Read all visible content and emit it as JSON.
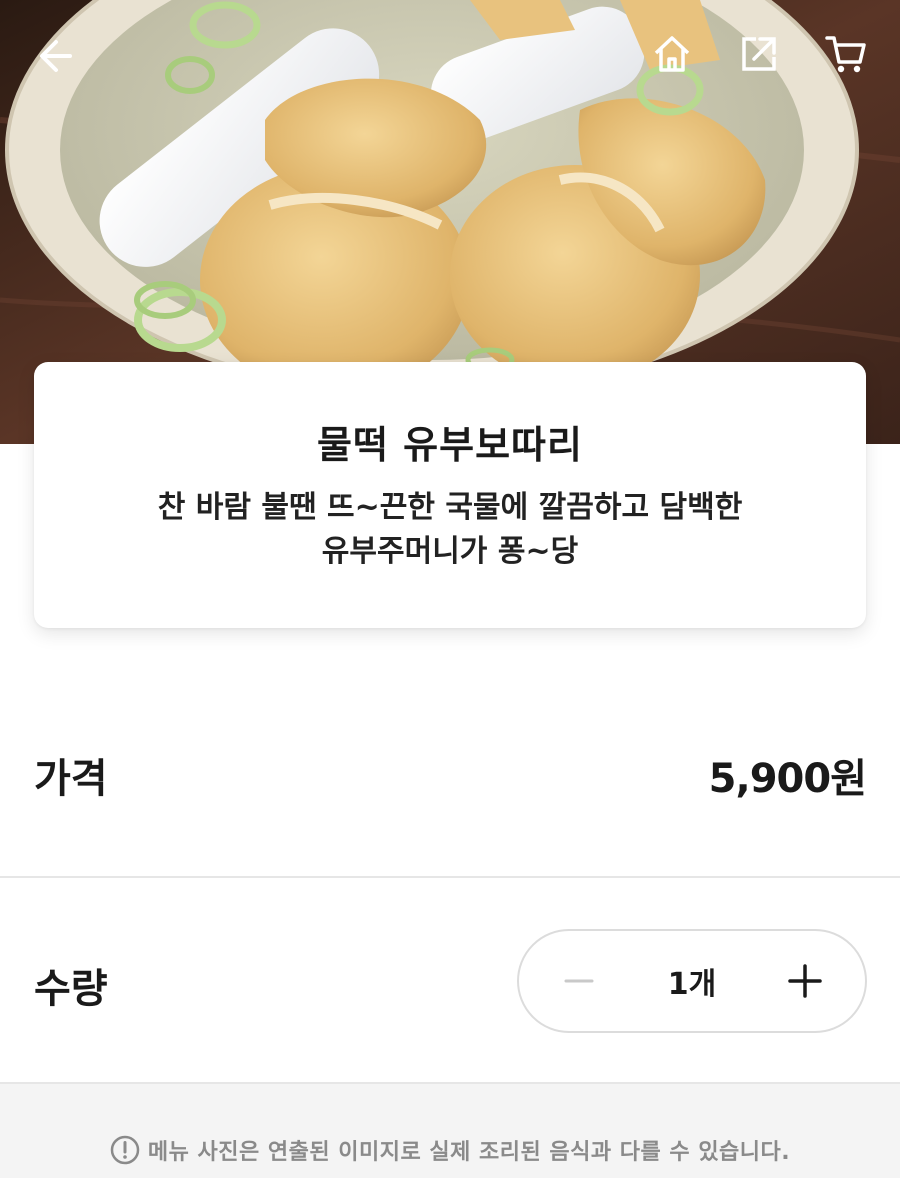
{
  "header": {
    "back_icon": "back-arrow-icon",
    "home_icon": "home-icon",
    "share_icon": "share-icon",
    "cart_icon": "cart-icon"
  },
  "product": {
    "name": "물떡 유부보따리",
    "description": "찬 바람 불땐 뜨~끈한 국물에 깔끔하고 담백한\n유부주머니가 퐁~당"
  },
  "price": {
    "label": "가격",
    "value": "5,900원"
  },
  "quantity": {
    "label": "수량",
    "value": "1개",
    "minus_icon": "minus-icon",
    "plus_icon": "plus-icon"
  },
  "notice": {
    "icon": "info-icon",
    "text": "메뉴 사진은 연출된 이미지로 실제 조리된 음식과 다를 수 있습니다."
  },
  "colors": {
    "text_primary": "#1a1a1a",
    "notice_text": "#8a8a8a",
    "divider": "#e6e6e6",
    "notice_bg": "#f4f4f4",
    "stepper_border": "#dcdcdc"
  }
}
